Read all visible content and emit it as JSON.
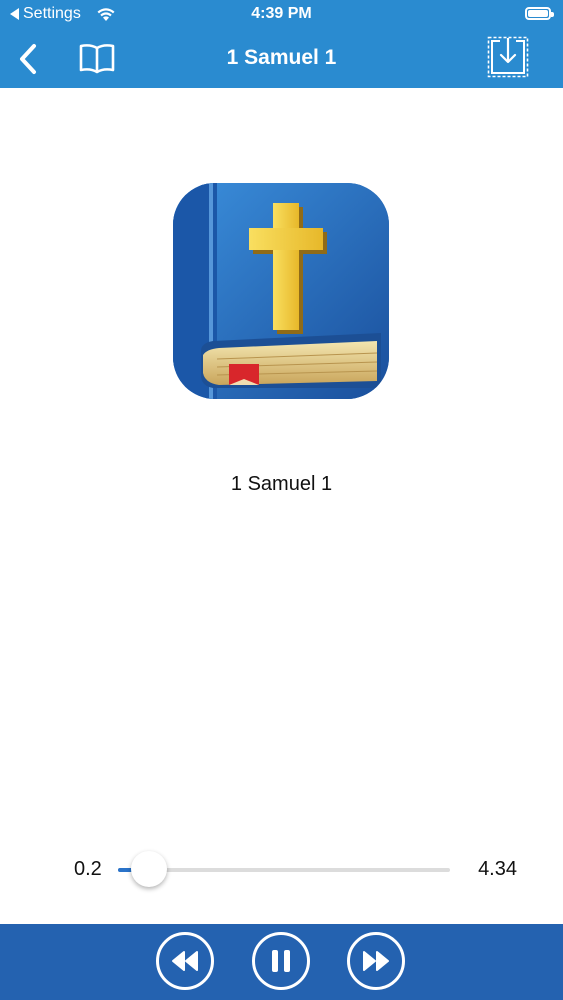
{
  "status_bar": {
    "back_app": "Settings",
    "time": "4:39 PM"
  },
  "nav": {
    "title": "1 Samuel 1"
  },
  "player": {
    "track_title": "1 Samuel 1",
    "elapsed": "0.2",
    "duration": "4.34",
    "progress": 0.05
  },
  "colors": {
    "header": "#2a8bd0",
    "controls_bar": "#2462b0",
    "accent": "#2a73c9"
  },
  "icons": {
    "back": "chevron-left-icon",
    "book": "open-book-icon",
    "download": "download-icon",
    "rewind": "rewind-icon",
    "pause": "pause-icon",
    "forward": "fast-forward-icon"
  }
}
